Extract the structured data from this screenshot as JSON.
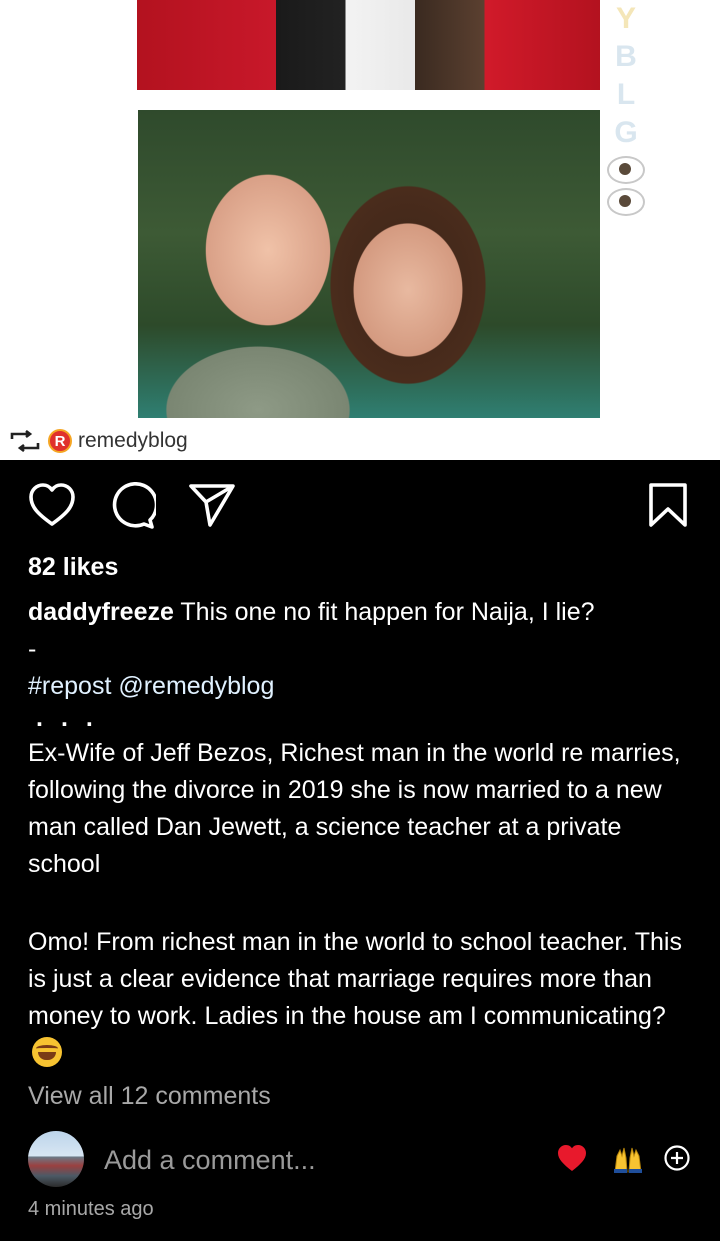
{
  "post": {
    "side_logo_letters": [
      "Y",
      "B",
      "L",
      "O",
      "G"
    ],
    "repost_credit": "remedyblog",
    "repost_badge": "R"
  },
  "actions": {
    "like_icon": "heart-icon",
    "comment_icon": "comment-icon",
    "share_icon": "send-icon",
    "save_icon": "bookmark-icon"
  },
  "likes": "82 likes",
  "caption": {
    "username": "daddyfreeze",
    "text": "This one no fit happen for Naija, I lie?",
    "dash": "-",
    "hashtag": "#repost",
    "mention": "@remedyblog",
    "dots": "...",
    "paragraph1": "Ex-Wife of Jeff Bezos, Richest man in the world re marries, following the divorce in 2019 she is now married to a new man called Dan Jewett, a science teacher at a private school",
    "paragraph2": "Omo! From richest man in the world to school teacher. This is just a clear evidence that marriage requires more than money to work. Ladies in the house am I communicating?",
    "emoji": "laughing-tears-emoji"
  },
  "view_comments": "View all 12 comments",
  "comment_box": {
    "placeholder": "Add a comment..."
  },
  "quick_reactions": [
    "❤️",
    "🙌"
  ],
  "timestamp": "4 minutes ago",
  "colors": {
    "background": "#000000",
    "text": "#ffffff",
    "muted": "#a8a8a8",
    "link": "#e0f1ff",
    "heart_red": "#e8192c",
    "badge_red": "#e0312c"
  }
}
